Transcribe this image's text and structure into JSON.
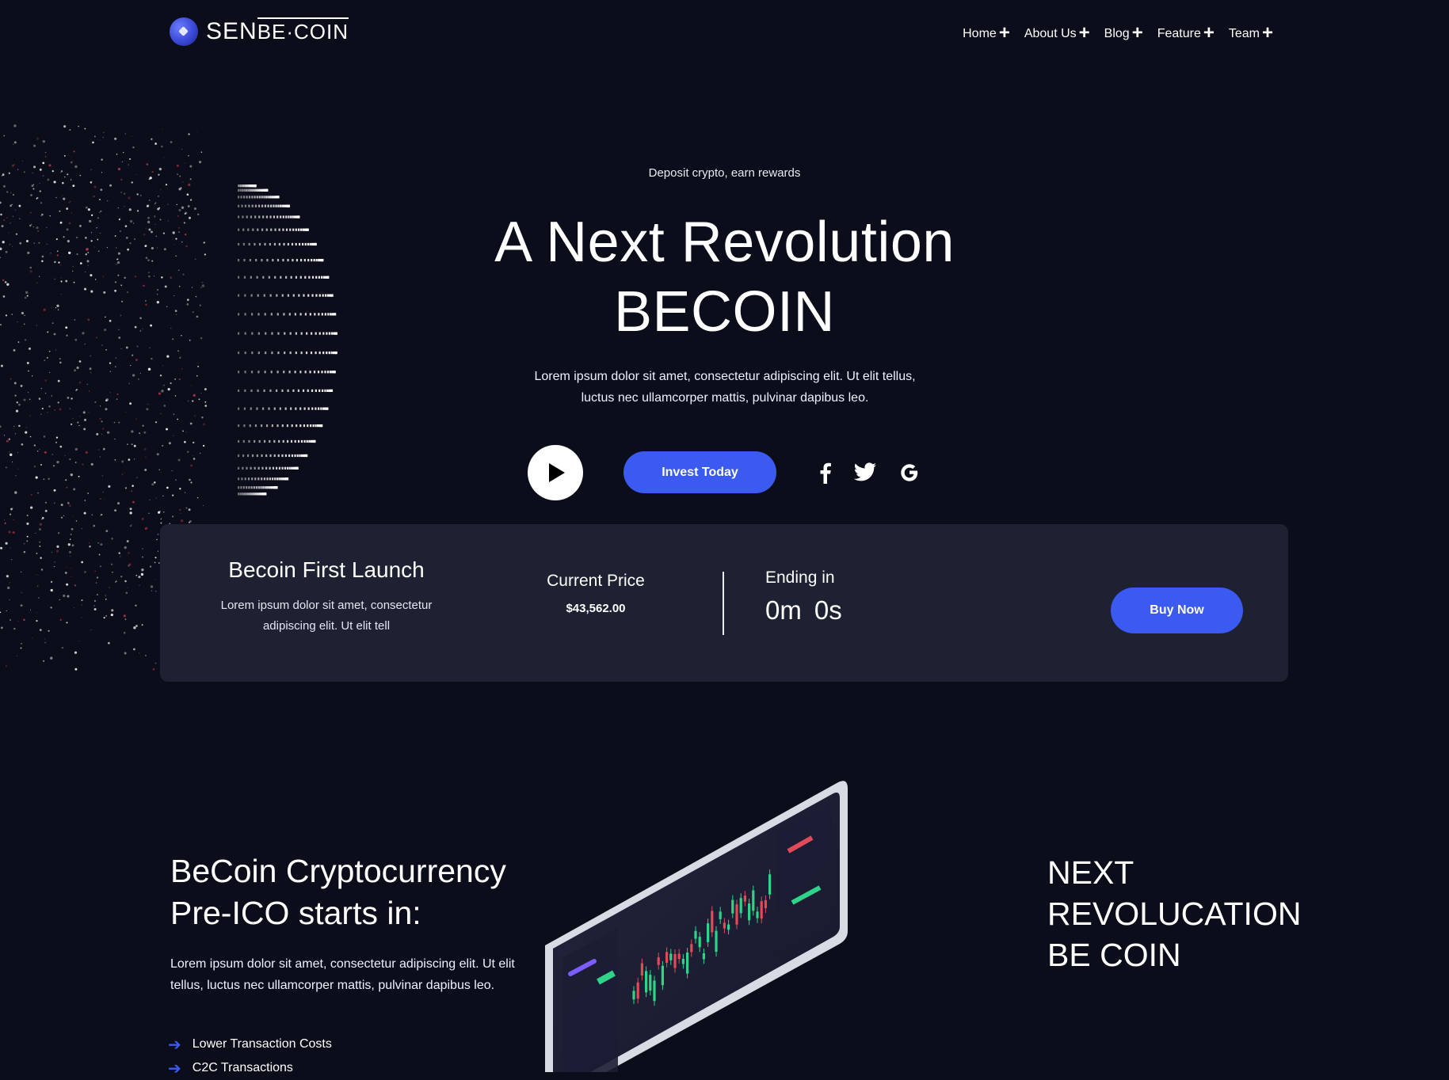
{
  "brand": {
    "logo_part1": "SEN",
    "logo_part2": "BE·COIN"
  },
  "nav": [
    {
      "label": "Home"
    },
    {
      "label": "About Us"
    },
    {
      "label": "Blog"
    },
    {
      "label": "Feature"
    },
    {
      "label": "Team"
    }
  ],
  "hero": {
    "tagline": "Deposit crypto, earn rewards",
    "title_line1": "A Next Revolution",
    "title_line2": "BECOIN",
    "desc_line1": "Lorem ipsum dolor sit amet, consectetur adipiscing elit. Ut elit tellus,",
    "desc_line2": "luctus nec ullamcorper mattis, pulvinar dapibus leo.",
    "invest_label": "Invest Today"
  },
  "launch": {
    "title": "Becoin First Launch",
    "desc_line1": "Lorem ipsum dolor sit amet, consectetur",
    "desc_line2": "adipiscing elit. Ut elit tell",
    "price_label": "Current Price",
    "price_value": "$43,562.00",
    "ending_label": "Ending in",
    "countdown_m": "0m",
    "countdown_s": "0s",
    "buy_label": "Buy Now"
  },
  "ico": {
    "title_line1": "BeCoin Cryptocurrency",
    "title_line2": "Pre-ICO starts in:",
    "desc_line1": "Lorem ipsum dolor sit amet, consectetur adipiscing elit. Ut elit",
    "desc_line2": "tellus, luctus nec ullamcorper mattis, pulvinar dapibus leo.",
    "features": [
      "Lower Transaction Costs",
      "C2C Transactions"
    ]
  },
  "next": {
    "line1": "NEXT",
    "line2": "REVOLUCATION",
    "line3": "BE COIN"
  },
  "colors": {
    "background": "#0b0e1a",
    "accent": "#3b5af2",
    "card": "#1d2131"
  },
  "icons": [
    "play-icon",
    "facebook-icon",
    "twitter-icon",
    "google-icon",
    "plus-icon",
    "arrow-right-icon"
  ]
}
